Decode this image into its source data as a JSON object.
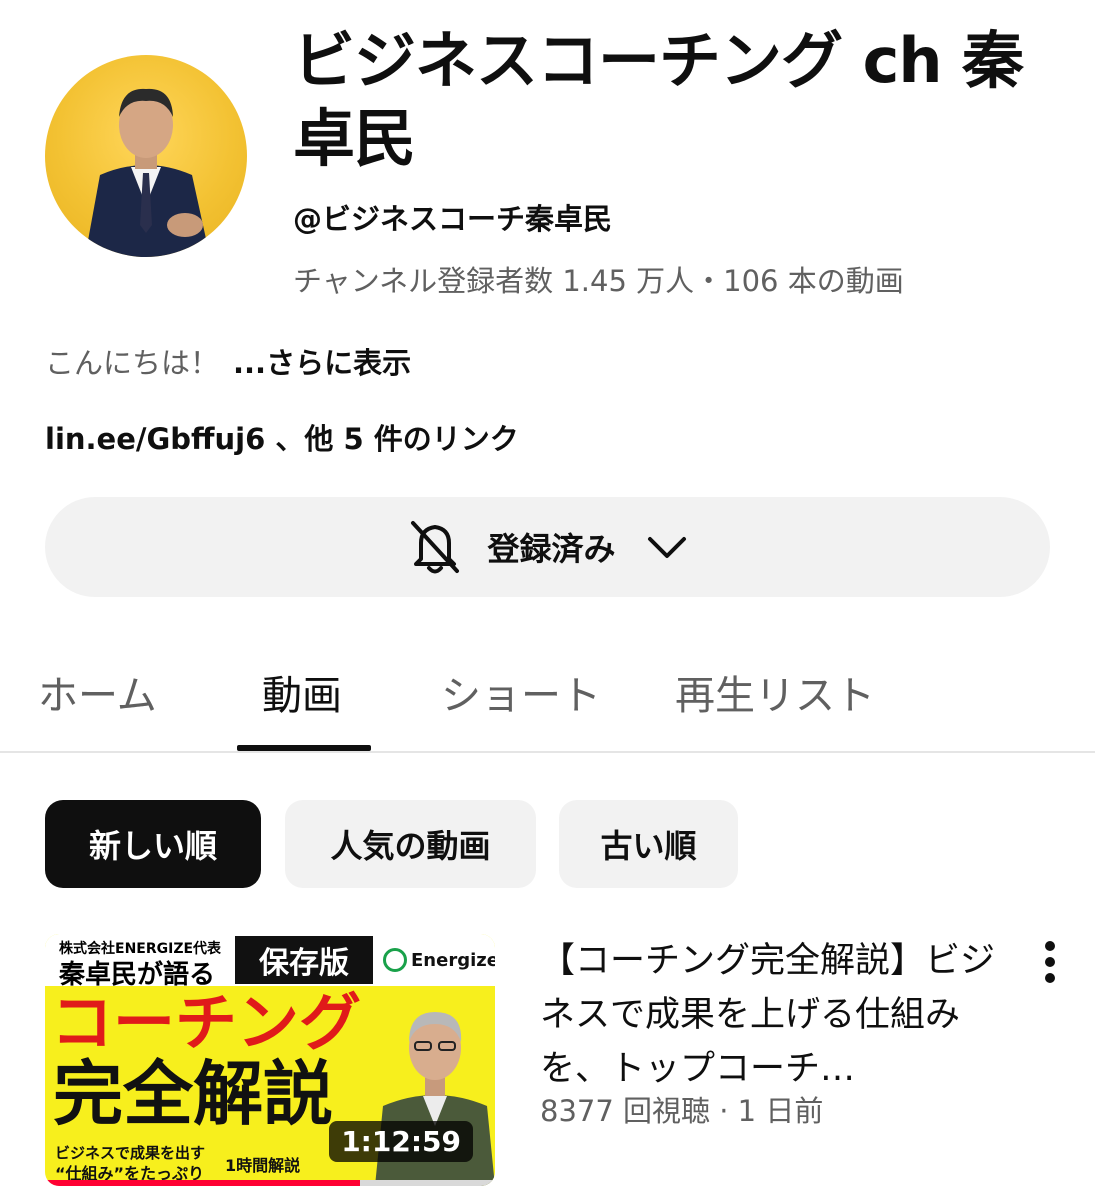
{
  "channel": {
    "title": "ビジネスコーチング ch 秦卓民",
    "handle": "@ビジネスコーチ秦卓民",
    "stats": "チャンネル登録者数 1.45 万人・106 本の動画",
    "description": "こんにちは！",
    "more_label": "...さらに表示",
    "links_text": "lin.ee/Gbffuj6 、他 5 件のリンク"
  },
  "subscribe": {
    "label": "登録済み",
    "icon": "bell-off-icon"
  },
  "tabs": [
    {
      "label": "ホーム"
    },
    {
      "label": "動画"
    },
    {
      "label": "ショート"
    },
    {
      "label": "再生リスト"
    }
  ],
  "active_tab": "動画",
  "chips": [
    {
      "label": "新しい順"
    },
    {
      "label": "人気の動画"
    },
    {
      "label": "古い順"
    }
  ],
  "video": {
    "title": "【コーチング完全解説】ビジネスで成果を上げる仕組みを、トップコーチ…",
    "meta": "8377 回視聴 · 1 日前",
    "duration": "1:12:59",
    "progress": 0.7,
    "thumb": {
      "corp": "株式会社ENERGIZE代表",
      "name": "秦卓民が語る",
      "badge": "保存版",
      "brand": "Energize",
      "headline1": "コーチング",
      "headline2": "完全解説",
      "sub1": "ビジネスで成果を出す",
      "sub2": "“仕組み”をたっぷり",
      "sub3": "1時間解説"
    }
  },
  "colors": {
    "accent": "#ff0033",
    "chip_bg": "#f2f2f2",
    "text_secondary": "#606060",
    "thumb_yellow": "#f7ef1d"
  }
}
